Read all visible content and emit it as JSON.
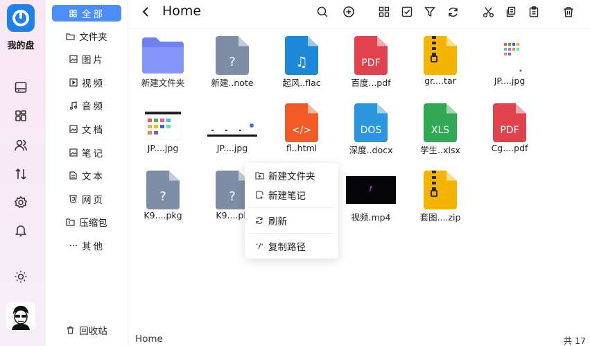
{
  "app": {
    "name": "我的盘"
  },
  "rail": {
    "items": [
      {
        "icon": "drive-icon"
      },
      {
        "icon": "apps-icon"
      },
      {
        "icon": "users-icon"
      },
      {
        "icon": "transfer-icon"
      },
      {
        "icon": "settings-icon"
      },
      {
        "icon": "bell-icon"
      },
      {
        "icon": "sun-icon"
      }
    ]
  },
  "categories": {
    "items": [
      {
        "label": "全部",
        "icon": "grid-icon",
        "active": true
      },
      {
        "label": "文件夹",
        "icon": "folder-icon"
      },
      {
        "label": "图片",
        "icon": "image-icon"
      },
      {
        "label": "视频",
        "icon": "video-icon"
      },
      {
        "label": "音频",
        "icon": "music-icon"
      },
      {
        "label": "文档",
        "icon": "document-icon"
      },
      {
        "label": "笔记",
        "icon": "note-icon"
      },
      {
        "label": "文本",
        "icon": "text-icon"
      },
      {
        "label": "网页",
        "icon": "html-icon"
      },
      {
        "label": "压缩包",
        "icon": "archive-icon"
      },
      {
        "label": "其他",
        "icon": "more-icon"
      }
    ],
    "recycle": "回收站"
  },
  "toolbar": {
    "title": "Home",
    "buttons": [
      "search-icon",
      "add-icon",
      "grid-view-icon",
      "select-icon",
      "filter-icon",
      "refresh-icon",
      "cut-icon",
      "copy-icon",
      "paste-icon",
      "delete-icon"
    ]
  },
  "files": [
    {
      "name": "新建文件夹",
      "kind": "folder"
    },
    {
      "name": "新建..note",
      "kind": "unknown"
    },
    {
      "name": "起风..flac",
      "kind": "audio"
    },
    {
      "name": "百度...pdf",
      "kind": "pdf"
    },
    {
      "name": "gr....tar",
      "kind": "zip"
    },
    {
      "name": "JP....jpg",
      "kind": "image"
    },
    {
      "name": "JP....jpg",
      "kind": "image"
    },
    {
      "name": "JP....jpg",
      "kind": "image"
    },
    {
      "name": "fl..html",
      "kind": "html"
    },
    {
      "name": "深度..docx",
      "kind": "doc"
    },
    {
      "name": "学生..xlsx",
      "kind": "xls"
    },
    {
      "name": "Cg....pdf",
      "kind": "pdf"
    },
    {
      "name": "K9....pkg",
      "kind": "unknown"
    },
    {
      "name": "K9....pk",
      "kind": "unknown"
    },
    {
      "name": "视频.mp4",
      "kind": "video"
    },
    {
      "name": "套图....zip",
      "kind": "zip"
    }
  ],
  "labels": {
    "pdf": "PDF",
    "doc": "DOS",
    "xls": "XLS",
    "html": "</>",
    "unknown": "?",
    "audio": "♫"
  },
  "colors": {
    "accent": "#4c8ef7",
    "folder": "#7b8cf6",
    "unknown": "#7d8ea6",
    "audio": "#1e88d8",
    "pdf": "#e0434e",
    "zip": "#f5b400",
    "html": "#f25a26",
    "doc": "#2b95e0",
    "xls": "#31a853"
  },
  "context_menu": {
    "items": [
      {
        "label": "新建文件夹",
        "icon": "new-folder-icon"
      },
      {
        "label": "新建笔记",
        "icon": "new-note-icon"
      },
      {
        "label": "刷新",
        "icon": "refresh-icon"
      },
      {
        "label": "复制路径",
        "icon": "copy-path-icon"
      }
    ]
  },
  "status": {
    "path": "Home",
    "count": "共 17"
  }
}
